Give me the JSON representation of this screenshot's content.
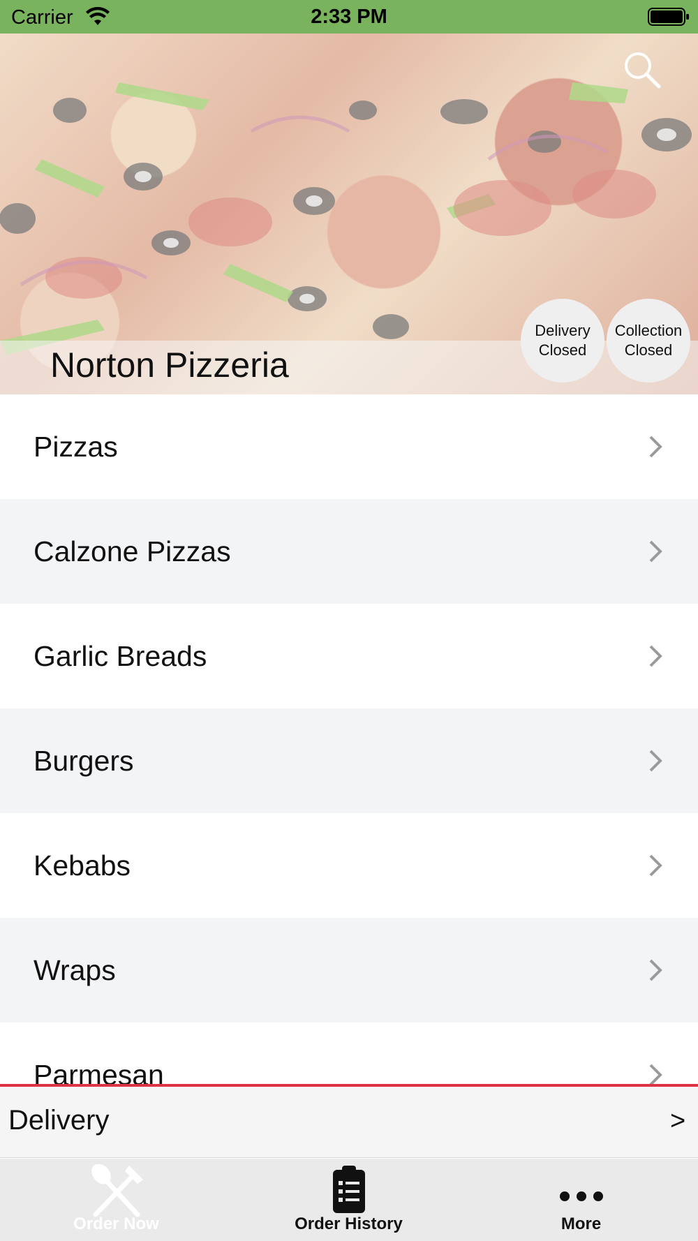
{
  "status_bar": {
    "carrier": "Carrier",
    "time": "2:33 PM"
  },
  "hero": {
    "store_name": "Norton Pizzeria",
    "delivery_status": {
      "line1": "Delivery",
      "line2": "Closed"
    },
    "collection_status": {
      "line1": "Collection",
      "line2": "Closed"
    },
    "search_icon": "search-icon"
  },
  "categories": [
    {
      "label": "Pizzas"
    },
    {
      "label": "Calzone Pizzas"
    },
    {
      "label": "Garlic Breads"
    },
    {
      "label": "Burgers"
    },
    {
      "label": "Kebabs"
    },
    {
      "label": "Wraps"
    },
    {
      "label": "Parmesan"
    }
  ],
  "order_type_bar": {
    "label": "Delivery",
    "arrow": ">"
  },
  "tabs": [
    {
      "label": "Order Now",
      "icon": "fork-knife-icon",
      "active": false
    },
    {
      "label": "Order History",
      "icon": "clipboard-list-icon",
      "active": true
    },
    {
      "label": "More",
      "icon": "ellipsis-icon",
      "active": true
    }
  ],
  "colors": {
    "status_bar": "#7ab35e",
    "accent_divider": "#dd3344",
    "row_alt": "#f3f4f6"
  }
}
